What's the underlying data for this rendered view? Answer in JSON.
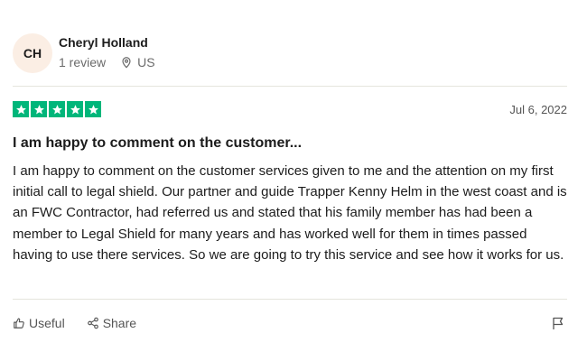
{
  "reviewer": {
    "initials": "CH",
    "name": "Cheryl Holland",
    "review_count": "1 review",
    "location": "US",
    "location_icon": "location-pin-icon",
    "avatar_bg": "#fbeee4"
  },
  "review": {
    "rating": 5,
    "max_rating": 5,
    "star_color": "#00b67a",
    "date": "Jul 6, 2022",
    "title": "I am happy to comment on the customer...",
    "body": "I am happy to comment on the customer services given to me and the attention on my first initial call to legal shield. Our partner and guide Trapper Kenny Helm in the west coast and is an FWC Contractor, had referred us and stated that his family member has had been a member to Legal Shield for many years and has worked well for them in times passed having to use there services. So we are going to try this service and see how it works for us."
  },
  "actions": {
    "useful_label": "Useful",
    "useful_icon": "thumbs-up-icon",
    "share_label": "Share",
    "share_icon": "share-icon",
    "flag_icon": "flag-icon"
  }
}
